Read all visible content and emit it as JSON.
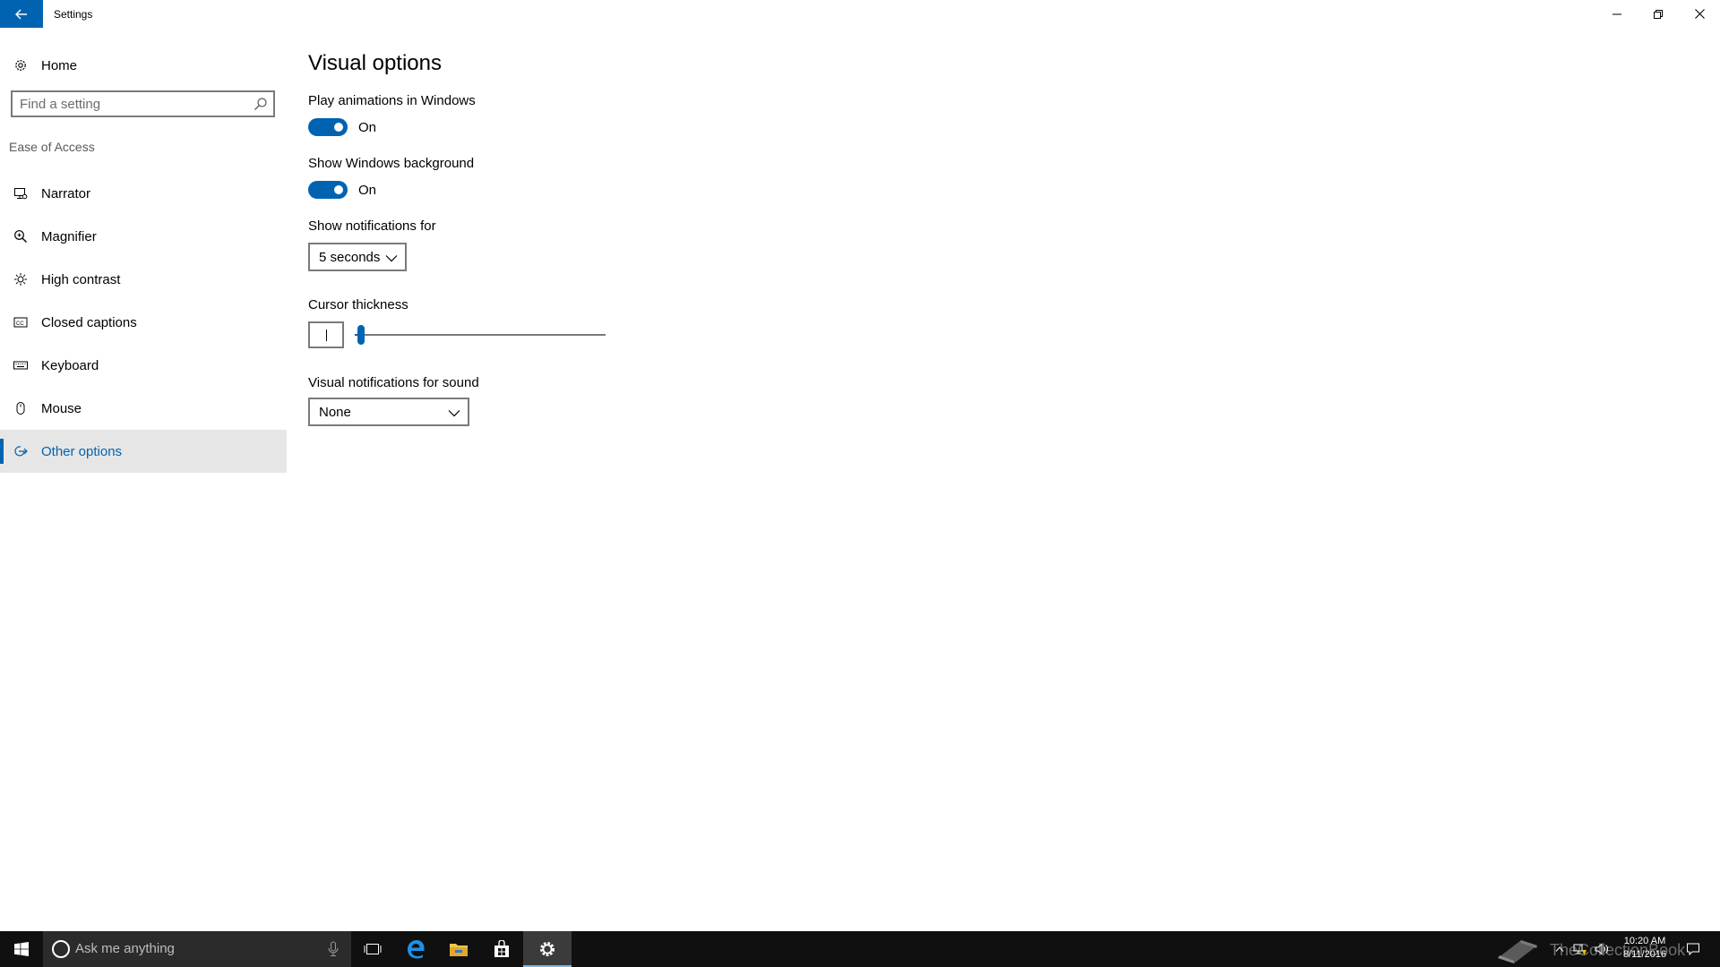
{
  "window": {
    "title": "Settings",
    "icons": {
      "back": "arrow-left-icon",
      "minimize": "minimize-icon",
      "maximize": "restore-icon",
      "close": "close-icon"
    }
  },
  "sidebar": {
    "home_label": "Home",
    "search_placeholder": "Find a setting",
    "section_label": "Ease of Access",
    "items": [
      {
        "label": "Narrator",
        "icon": "narrator-icon"
      },
      {
        "label": "Magnifier",
        "icon": "magnifier-icon"
      },
      {
        "label": "High contrast",
        "icon": "high-contrast-icon"
      },
      {
        "label": "Closed captions",
        "icon": "closed-captions-icon"
      },
      {
        "label": "Keyboard",
        "icon": "keyboard-icon"
      },
      {
        "label": "Mouse",
        "icon": "mouse-icon"
      },
      {
        "label": "Other options",
        "icon": "other-options-icon",
        "active": true
      }
    ]
  },
  "content": {
    "title": "Visual options",
    "animations": {
      "label": "Play animations in Windows",
      "state": "On"
    },
    "background": {
      "label": "Show Windows background",
      "state": "On"
    },
    "notifications": {
      "label": "Show notifications for",
      "value": "5 seconds"
    },
    "cursor": {
      "label": "Cursor thickness",
      "level_fraction": 0.01
    },
    "sound": {
      "label": "Visual notifications for sound",
      "value": "None"
    }
  },
  "taskbar": {
    "search_placeholder": "Ask me anything",
    "watermark": "TheCollectionBook",
    "time": "10:20 AM",
    "date": "8/11/2016"
  },
  "colors": {
    "accent": "#0063b1",
    "taskbar": "#101010",
    "selected_nav": "#e6e6e6"
  }
}
